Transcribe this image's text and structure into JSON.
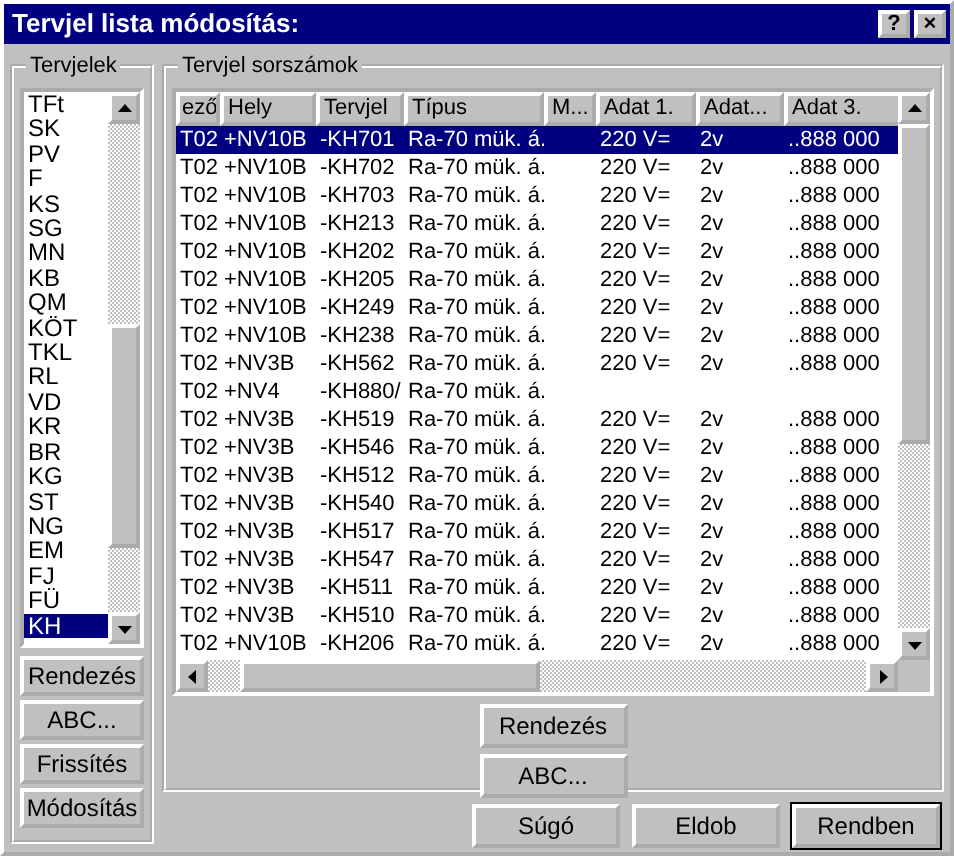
{
  "window": {
    "title": "Tervjel lista módosítás:",
    "title_buttons": [
      "?",
      "×"
    ]
  },
  "left_group": {
    "title": "Tervjelek",
    "items": [
      {
        "label": "TFt",
        "selected": false
      },
      {
        "label": "SK",
        "selected": false
      },
      {
        "label": "PV",
        "selected": false
      },
      {
        "label": "F",
        "selected": false
      },
      {
        "label": "KS",
        "selected": false
      },
      {
        "label": "SG",
        "selected": false
      },
      {
        "label": "MN",
        "selected": false
      },
      {
        "label": "KB",
        "selected": false
      },
      {
        "label": "QM",
        "selected": false
      },
      {
        "label": "KÖT",
        "selected": false
      },
      {
        "label": "TKL",
        "selected": false
      },
      {
        "label": "RL",
        "selected": false
      },
      {
        "label": "VD",
        "selected": false
      },
      {
        "label": "KR",
        "selected": false
      },
      {
        "label": "BR",
        "selected": false
      },
      {
        "label": "KG",
        "selected": false
      },
      {
        "label": "ST",
        "selected": false
      },
      {
        "label": "NG",
        "selected": false
      },
      {
        "label": "EM",
        "selected": false
      },
      {
        "label": "FJ",
        "selected": false
      },
      {
        "label": "FÜ",
        "selected": false
      },
      {
        "label": "KH",
        "selected": true
      }
    ],
    "buttons": [
      "Rendezés",
      "ABC...",
      "Frissítés",
      "Módosítás"
    ]
  },
  "right_group": {
    "title": "Tervjel sorszámok",
    "table": {
      "columns": [
        "ező",
        "Hely",
        "Tervjel",
        "Típus",
        "M...",
        "Adat 1.",
        "Adat...",
        "Adat 3."
      ],
      "rows": [
        {
          "cells": [
            "T02",
            "+NV10B",
            "-KH701",
            "Ra-70 mük. á.",
            "",
            "220 V=",
            "2v",
            "..888 000"
          ],
          "selected": true
        },
        {
          "cells": [
            "T02",
            "+NV10B",
            "-KH702",
            "Ra-70 mük. á.",
            "",
            "220 V=",
            "2v",
            "..888 000"
          ],
          "selected": false
        },
        {
          "cells": [
            "T02",
            "+NV10B",
            "-KH703",
            "Ra-70 mük. á.",
            "",
            "220 V=",
            "2v",
            "..888 000"
          ],
          "selected": false
        },
        {
          "cells": [
            "T02",
            "+NV10B",
            "-KH213",
            "Ra-70 mük. á.",
            "",
            "220 V=",
            "2v",
            "..888 000"
          ],
          "selected": false
        },
        {
          "cells": [
            "T02",
            "+NV10B",
            "-KH202",
            "Ra-70 mük. á.",
            "",
            "220 V=",
            "2v",
            "..888 000"
          ],
          "selected": false
        },
        {
          "cells": [
            "T02",
            "+NV10B",
            "-KH205",
            "Ra-70 mük. á.",
            "",
            "220 V=",
            "2v",
            "..888 000"
          ],
          "selected": false
        },
        {
          "cells": [
            "T02",
            "+NV10B",
            "-KH249",
            "Ra-70 mük. á.",
            "",
            "220 V=",
            "2v",
            "..888 000"
          ],
          "selected": false
        },
        {
          "cells": [
            "T02",
            "+NV10B",
            "-KH238",
            "Ra-70 mük. á.",
            "",
            "220 V=",
            "2v",
            "..888 000"
          ],
          "selected": false
        },
        {
          "cells": [
            "T02",
            "+NV3B",
            "-KH562",
            "Ra-70 mük. á.",
            "",
            "220 V=",
            "2v",
            "..888 000"
          ],
          "selected": false
        },
        {
          "cells": [
            "T02",
            "+NV4",
            "-KH880/",
            "Ra-70 mük. á.",
            "",
            "",
            "",
            ""
          ],
          "selected": false
        },
        {
          "cells": [
            "T02",
            "+NV3B",
            "-KH519",
            "Ra-70 mük. á.",
            "",
            "220 V=",
            "2v",
            "..888 000"
          ],
          "selected": false
        },
        {
          "cells": [
            "T02",
            "+NV3B",
            "-KH546",
            "Ra-70 mük. á.",
            "",
            "220 V=",
            "2v",
            "..888 000"
          ],
          "selected": false
        },
        {
          "cells": [
            "T02",
            "+NV3B",
            "-KH512",
            "Ra-70 mük. á.",
            "",
            "220 V=",
            "2v",
            "..888 000"
          ],
          "selected": false
        },
        {
          "cells": [
            "T02",
            "+NV3B",
            "-KH540",
            "Ra-70 mük. á.",
            "",
            "220 V=",
            "2v",
            "..888 000"
          ],
          "selected": false
        },
        {
          "cells": [
            "T02",
            "+NV3B",
            "-KH517",
            "Ra-70 mük. á.",
            "",
            "220 V=",
            "2v",
            "..888 000"
          ],
          "selected": false
        },
        {
          "cells": [
            "T02",
            "+NV3B",
            "-KH547",
            "Ra-70 mük. á.",
            "",
            "220 V=",
            "2v",
            "..888 000"
          ],
          "selected": false
        },
        {
          "cells": [
            "T02",
            "+NV3B",
            "-KH511",
            "Ra-70 mük. á.",
            "",
            "220 V=",
            "2v",
            "..888 000"
          ],
          "selected": false
        },
        {
          "cells": [
            "T02",
            "+NV3B",
            "-KH510",
            "Ra-70 mük. á.",
            "",
            "220 V=",
            "2v",
            "..888 000"
          ],
          "selected": false
        },
        {
          "cells": [
            "T02",
            "+NV10B",
            "-KH206",
            "Ra-70 mük. á.",
            "",
            "220 V=",
            "2v",
            "..888 000"
          ],
          "selected": false
        }
      ]
    },
    "buttons": [
      "Rendezés",
      "ABC..."
    ]
  },
  "footer_buttons": [
    {
      "label": "Súgó",
      "default": false
    },
    {
      "label": "Eldob",
      "default": false
    },
    {
      "label": "Rendben",
      "default": true
    }
  ]
}
